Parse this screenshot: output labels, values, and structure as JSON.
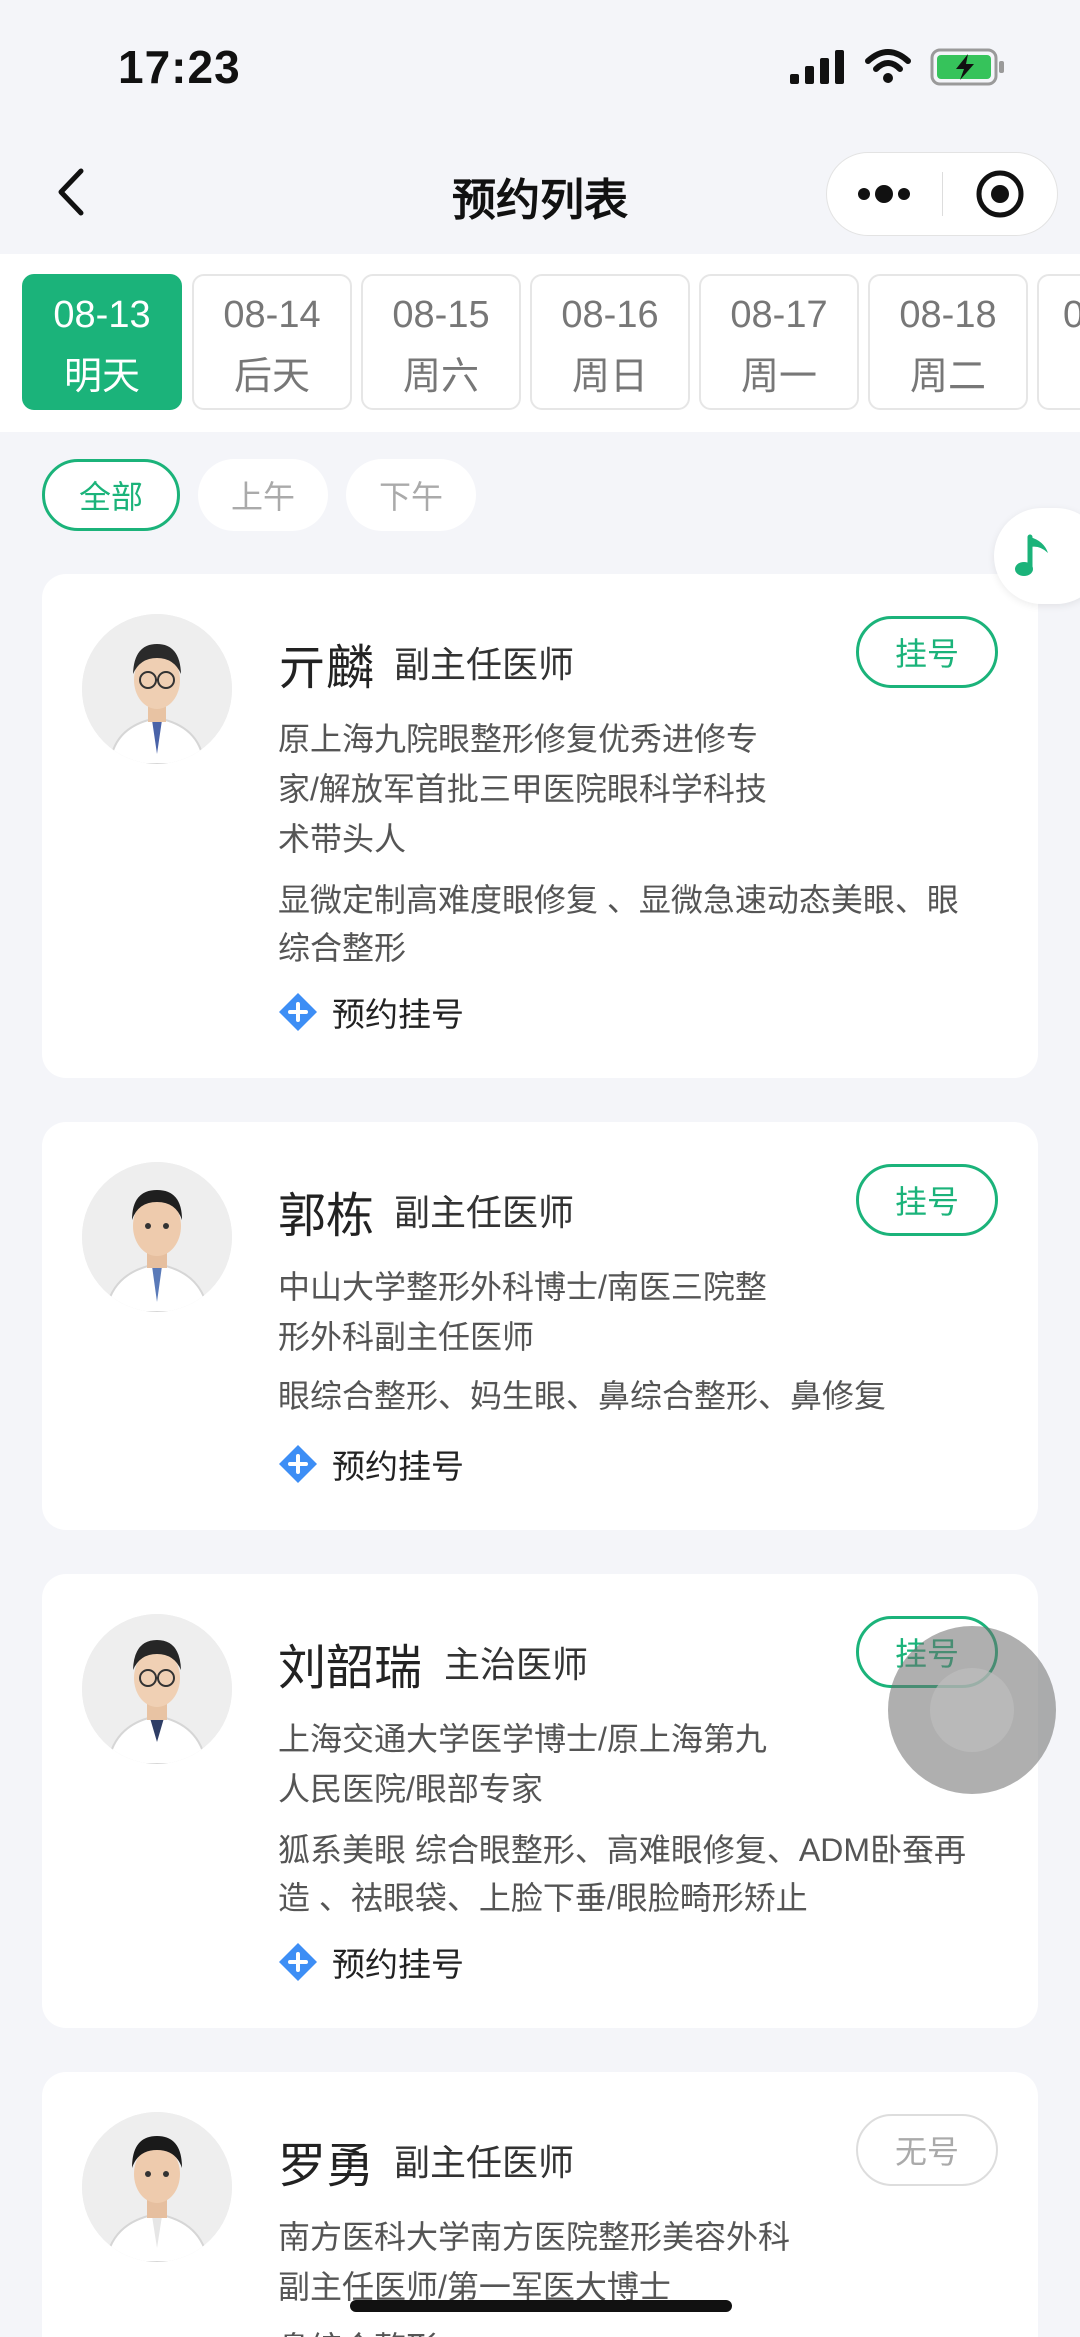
{
  "status_bar": {
    "time": "17:23"
  },
  "nav": {
    "title": "预约列表"
  },
  "dates": [
    {
      "date": "08-13",
      "label": "明天",
      "active": true
    },
    {
      "date": "08-14",
      "label": "后天",
      "active": false
    },
    {
      "date": "08-15",
      "label": "周六",
      "active": false
    },
    {
      "date": "08-16",
      "label": "周日",
      "active": false
    },
    {
      "date": "08-17",
      "label": "周一",
      "active": false
    },
    {
      "date": "08-18",
      "label": "周二",
      "active": false
    },
    {
      "date": "0",
      "label": "",
      "active": false
    }
  ],
  "periods": [
    {
      "label": "全部",
      "active": true
    },
    {
      "label": "上午",
      "active": false
    },
    {
      "label": "下午",
      "active": false
    }
  ],
  "book_label": "预约挂号",
  "doctors": [
    {
      "name": "亓麟",
      "title": "副主任医师",
      "button": "挂号",
      "available": true,
      "intro": [
        "原上海九院眼整形修复优秀进修专",
        "家/解放军首批三甲医院眼科学科技",
        "术带头人"
      ],
      "tags": [
        "显微定制高难度眼修复 、显微急速动态美眼、眼",
        "综合整形"
      ]
    },
    {
      "name": "郭栋",
      "title": "副主任医师",
      "button": "挂号",
      "available": true,
      "intro": [
        "中山大学整形外科博士/南医三院整",
        "形外科副主任医师"
      ],
      "tags": [
        "眼综合整形、妈生眼、鼻综合整形、鼻修复"
      ]
    },
    {
      "name": "刘韶瑞",
      "title": "主治医师",
      "button": "挂号",
      "available": true,
      "intro": [
        "上海交通大学医学博士/原上海第九",
        "人民医院/眼部专家"
      ],
      "tags": [
        "狐系美眼 综合眼整形、高难眼修复、ADM卧蚕再",
        "造 、祛眼袋、上脸下垂/眼脸畸形矫止"
      ]
    },
    {
      "name": "罗勇",
      "title": "副主任医师",
      "button": "无号",
      "available": false,
      "intro": [
        "南方医科大学南方医院整形美容外科",
        "副主任医师/第一军医大博士"
      ],
      "tags": [
        "鼻综合整形、..."
      ]
    }
  ],
  "colors": {
    "accent": "#1bb37a",
    "background": "#f4f5f9",
    "card": "#ffffff",
    "diamond_icon": "#3d8ef5"
  }
}
